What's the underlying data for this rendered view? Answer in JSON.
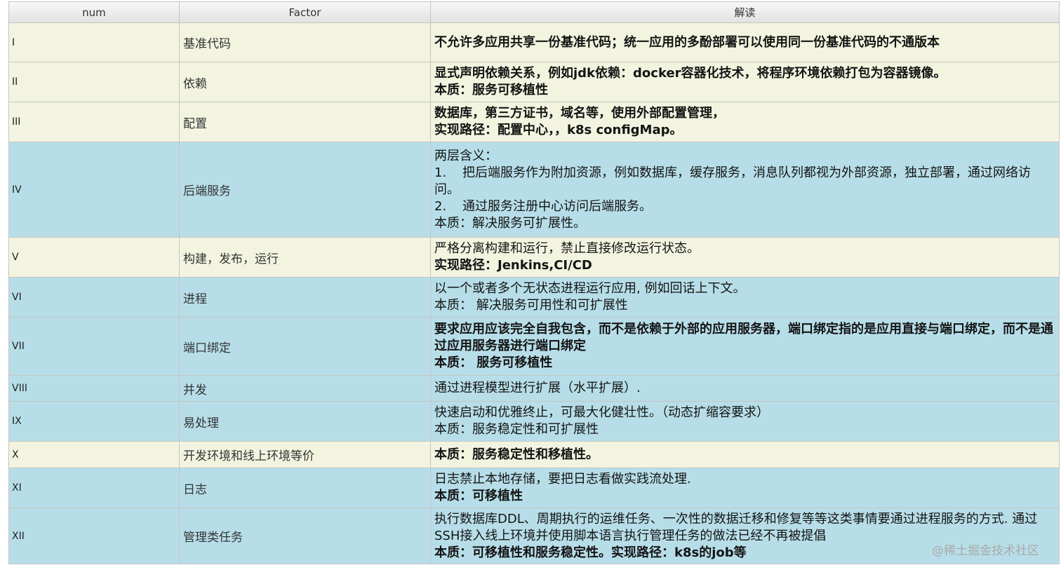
{
  "header": {
    "num": "num",
    "factor": "Factor",
    "desc": "解读"
  },
  "colors": {
    "cream": "#f3f4e0",
    "blue": "#b7dee8",
    "border": "#c4c4c4"
  },
  "rows": [
    {
      "num": "I",
      "factor": "基准代码",
      "bg": "#f3f4e0",
      "desc": [
        {
          "t": "不允许多应用共享一份基准代码；统一应用的多酚部署可以使用同一份基准代码的不通版本",
          "b": true
        }
      ]
    },
    {
      "num": "II",
      "factor": "依赖",
      "bg": "#f3f4e0",
      "desc": [
        {
          "t": "显式声明依赖关系，例如jdk依赖：docker容器化技术，将程序环境依赖打包为容器镜像。",
          "b": true
        },
        {
          "t": "本质：服务可移植性",
          "b": true
        }
      ]
    },
    {
      "num": "III",
      "factor": "配置",
      "bg": "#f3f4e0",
      "desc": [
        {
          "t": "数据库，第三方证书，域名等，使用外部配置管理，",
          "b": true
        },
        {
          "t": "实现路径：配置中心，，k8s configMap。",
          "b": true
        }
      ]
    },
    {
      "num": "IV",
      "factor": "后端服务",
      "bg": "#b7dee8",
      "desc": [
        {
          "t": "两层含义：",
          "b": false
        },
        {
          "t": "1.    把后端服务作为附加资源，例如数据库，缓存服务，消息队列都视为外部资源，独立部署，通过网络访问。",
          "b": false
        },
        {
          "t": "2.    通过服务注册中心访问后端服务。",
          "b": false
        },
        {
          "t": "本质：解决服务可扩展性。",
          "b": false
        }
      ]
    },
    {
      "num": "V",
      "factor": "构建，发布，运行",
      "bg": "#f3f4e0",
      "desc": [
        {
          "t": "严格分离构建和运行，禁止直接修改运行状态。",
          "b": false
        },
        {
          "t": "实现路径：Jenkins,CI/CD",
          "b": true
        }
      ]
    },
    {
      "num": "VI",
      "factor": "进程",
      "bg": "#b7dee8",
      "desc": [
        {
          "t": "以一个或者多个无状态进程运行应用, 例如回话上下文。",
          "b": false
        },
        {
          "t": "本质： 解决服务可用性和可扩展性",
          "b": false
        }
      ]
    },
    {
      "num": "VII",
      "factor": "端口绑定",
      "bg": "#b7dee8",
      "desc": [
        {
          "t": "要求应用应该完全自我包含，而不是依赖于外部的应用服务器，端口绑定指的是应用直接与端口绑定，而不是通过应用服务器进行端口绑定",
          "b": true
        },
        {
          "t": "本质： 服务可移植性",
          "b": true
        }
      ]
    },
    {
      "num": "VIII",
      "factor": "并发",
      "bg": "#b7dee8",
      "desc": [
        {
          "t": "通过进程模型进行扩展（水平扩展）.",
          "b": false
        }
      ]
    },
    {
      "num": "IX",
      "factor": "易处理",
      "bg": "#b7dee8",
      "desc": [
        {
          "t": "快速启动和优雅终止，可最大化健壮性。（动态扩缩容要求）",
          "b": false
        },
        {
          "t": "本质：服务稳定性和可扩展性",
          "b": false
        }
      ]
    },
    {
      "num": "X",
      "factor": "开发环境和线上环境等价",
      "bg": "#f3f4e0",
      "desc": [
        {
          "t": "本质：服务稳定性和移植性。",
          "b": true
        }
      ]
    },
    {
      "num": "XI",
      "factor": "日志",
      "bg": "#b7dee8",
      "desc": [
        {
          "t": "日志禁止本地存储，要把日志看做实践流处理.",
          "b": false
        },
        {
          "t": "本质：可移植性",
          "b": true
        }
      ]
    },
    {
      "num": "XII",
      "factor": "管理类任务",
      "bg": "#b7dee8",
      "desc": [
        {
          "t": "执行数据库DDL、周期执行的运维任务、一次性的数据迁移和修复等等这类事情要通过进程服务的方式. 通过SSH接入线上环境并使用脚本语言执行管理任务的做法已经不再被提倡",
          "b": false
        },
        {
          "t": "本质：可移植性和服务稳定性。实现路径：k8s的job等",
          "b": true
        }
      ]
    }
  ],
  "watermark": "@稀土掘金技术社区"
}
